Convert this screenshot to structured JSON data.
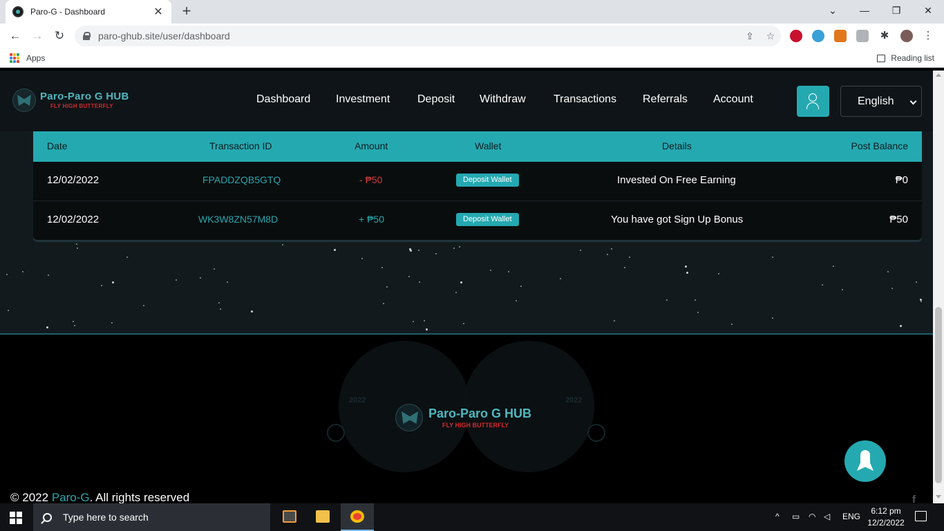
{
  "browser": {
    "tab_title": "Paro-G - Dashboard",
    "url": "paro-ghub.site/user/dashboard",
    "bookmarks": {
      "apps_label": "Apps",
      "reading_list_label": "Reading list"
    },
    "icons": [
      "close-icon",
      "new-tab-icon",
      "minimize-icon",
      "restore-icon",
      "back-icon",
      "forward-icon",
      "reload-icon",
      "lock-icon",
      "share-icon",
      "star-icon",
      "extensions-icon",
      "profile-icon"
    ]
  },
  "site": {
    "brand": {
      "title": "Paro-Paro G HUB",
      "tagline": "FLY HIGH BUTTERFLY"
    },
    "nav": [
      {
        "label": "Dashboard"
      },
      {
        "label": "Investment"
      },
      {
        "label": "Deposit"
      },
      {
        "label": "Withdraw"
      },
      {
        "label": "Transactions"
      },
      {
        "label": "Referrals"
      },
      {
        "label": "Account"
      }
    ],
    "language": "English",
    "colors": {
      "accent": "#25a9b1",
      "negative": "#d13a3a",
      "header_bg": "#0e1417"
    }
  },
  "transactions": {
    "headers": {
      "date": "Date",
      "transaction_id": "Transaction ID",
      "amount": "Amount",
      "wallet": "Wallet",
      "details": "Details",
      "post_balance": "Post Balance"
    },
    "rows": [
      {
        "date": "12/02/2022",
        "transaction_id": "FPADDZQB5GTQ",
        "amount": "- ₱50",
        "wallet": "Deposit Wallet",
        "details": "Invested On Free Earning",
        "post_balance": "₱0"
      },
      {
        "date": "12/02/2022",
        "transaction_id": "WK3W8ZN57M8D",
        "amount": "+ ₱50",
        "wallet": "Deposit Wallet",
        "details": "You have got Sign Up Bonus",
        "post_balance": "₱50"
      }
    ]
  },
  "footer": {
    "logo_title": "Paro-Paro G HUB",
    "logo_tagline": "FLY HIGH BUTTERFLY",
    "emblem_year": "2022",
    "copyright_prefix": "© 2022",
    "copyright_link": "Paro-G",
    "copyright_suffix": ". All rights reserved",
    "social": "f"
  },
  "taskbar": {
    "search_placeholder": "Type here to search",
    "language": "ENG",
    "time": "6:12 pm",
    "date": "12/2/2022"
  }
}
